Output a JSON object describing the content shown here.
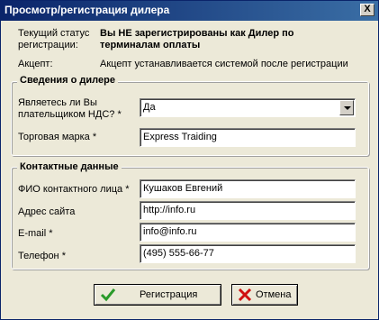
{
  "window": {
    "title": "Просмотр/регистрация дилера",
    "close_glyph": "X"
  },
  "status": {
    "status_label_line1": "Текущий статус",
    "status_label_line2": "регистрации:",
    "status_value_line1": "Вы НЕ зарегистрированы как Дилер по",
    "status_value_line2": "терминалам оплаты",
    "accept_label": "Акцепт:",
    "accept_value": "Акцепт устанавливается системой после регистрации"
  },
  "dealer_info": {
    "legend": "Сведения о дилере",
    "vat_label_line1": "Являетесь ли Вы",
    "vat_label_line2": "плательщиком НДС? *",
    "vat_value": "Да",
    "brand_label": "Торговая марка *",
    "brand_value": "Express Traiding"
  },
  "contacts": {
    "legend": "Контактные данные",
    "name_label": "ФИО контактного лица *",
    "name_value": "Кушаков Евгений",
    "site_label": "Адрес сайта",
    "site_value": "http://info.ru",
    "email_label": "E-mail *",
    "email_value": "info@info.ru",
    "phone_label": "Телефон *",
    "phone_value": "(495) 555-66-77"
  },
  "buttons": {
    "register_label": "Регистрация",
    "cancel_label": "Отмена"
  },
  "icons": {
    "register": "checkmark-icon",
    "cancel": "cross-icon"
  },
  "colors": {
    "titlebar": "#0a246a",
    "dialog": "#ece9d8",
    "check": "#2a9a2a",
    "cross": "#d01010"
  }
}
